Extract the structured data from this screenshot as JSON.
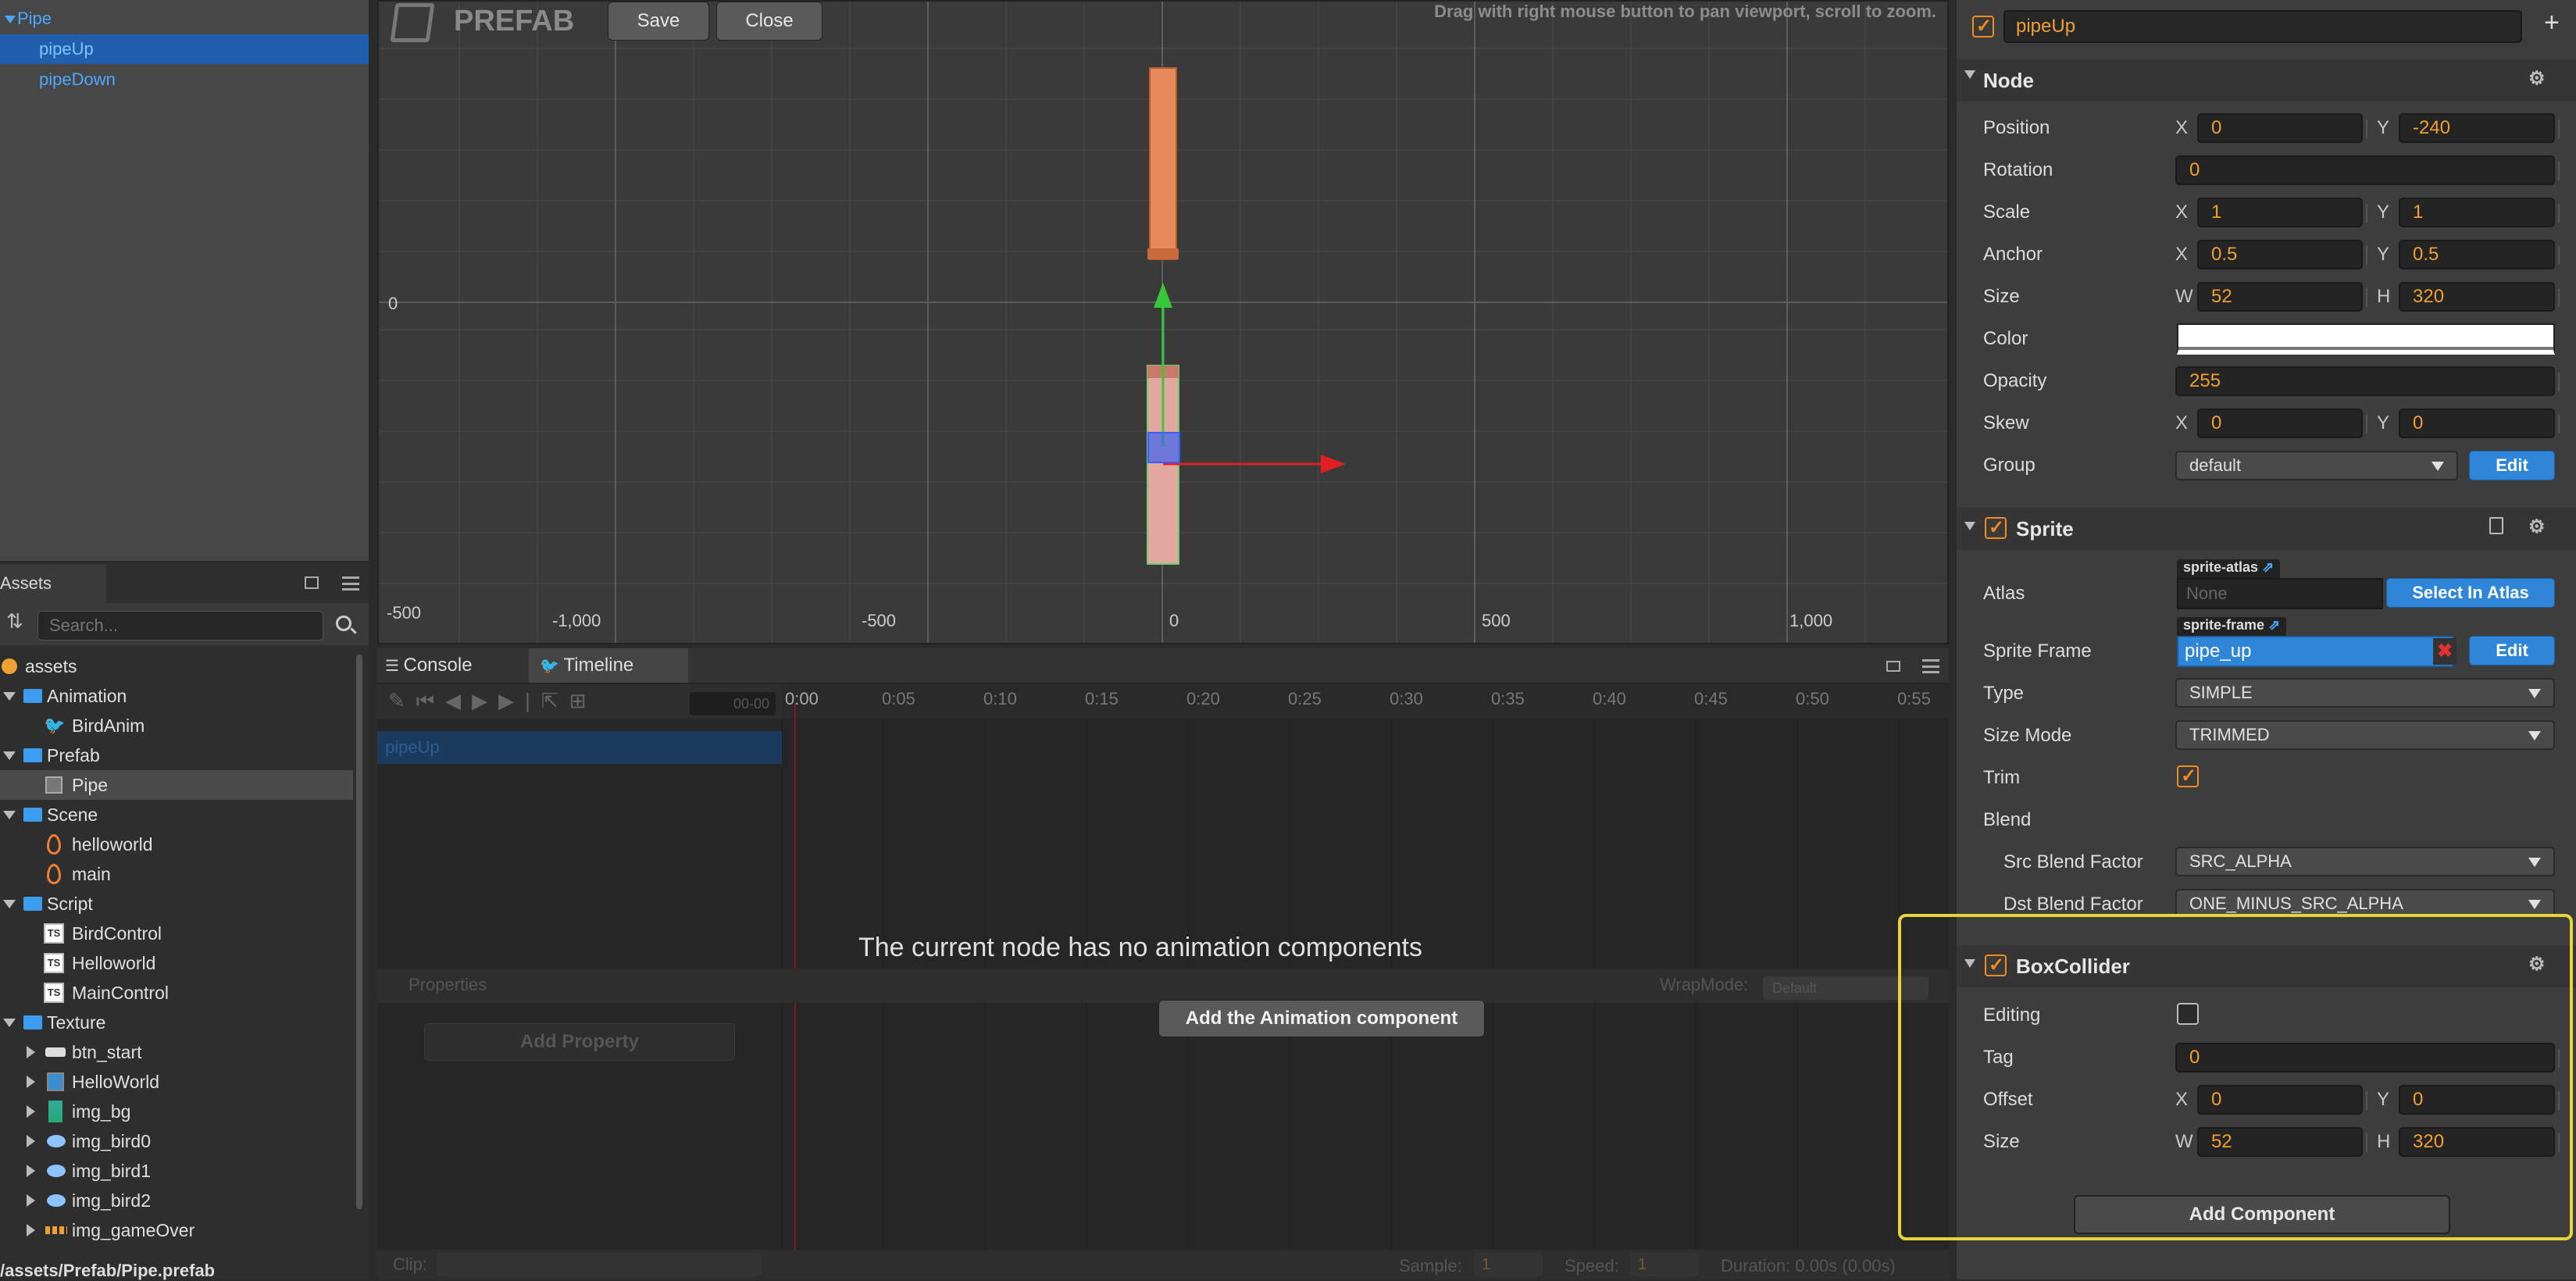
{
  "hierarchy": {
    "root": "Pipe",
    "children": [
      "pipeUp",
      "pipeDown"
    ]
  },
  "assets_panel": {
    "tab": "Assets",
    "search_placeholder": "Search...",
    "tree": [
      {
        "label": "assets",
        "kind": "root"
      },
      {
        "label": "Animation",
        "kind": "folder"
      },
      {
        "label": "BirdAnim",
        "kind": "anim"
      },
      {
        "label": "Prefab",
        "kind": "folder"
      },
      {
        "label": "Pipe",
        "kind": "prefab"
      },
      {
        "label": "Scene",
        "kind": "folder"
      },
      {
        "label": "helloworld",
        "kind": "scene"
      },
      {
        "label": "main",
        "kind": "scene"
      },
      {
        "label": "Script",
        "kind": "folder"
      },
      {
        "label": "BirdControl",
        "kind": "ts"
      },
      {
        "label": "Helloworld",
        "kind": "ts"
      },
      {
        "label": "MainControl",
        "kind": "ts"
      },
      {
        "label": "Texture",
        "kind": "folder"
      },
      {
        "label": "btn_start",
        "kind": "tex"
      },
      {
        "label": "HelloWorld",
        "kind": "tex"
      },
      {
        "label": "img_bg",
        "kind": "tex"
      },
      {
        "label": "img_bird0",
        "kind": "tex"
      },
      {
        "label": "img_bird1",
        "kind": "tex"
      },
      {
        "label": "img_bird2",
        "kind": "tex"
      },
      {
        "label": "img_gameOver",
        "kind": "tex"
      }
    ],
    "path": "/assets/Prefab/Pipe.prefab"
  },
  "scene": {
    "mode_label": "PREFAB",
    "save": "Save",
    "close": "Close",
    "hint": "Drag with right mouse button to pan viewport, scroll to zoom.",
    "y_labels": [
      "0",
      "-500"
    ],
    "x_labels": [
      "-1,000",
      "-500",
      "0",
      "500",
      "1,000"
    ]
  },
  "timeline": {
    "tab_console": "Console",
    "tab_timeline": "Timeline",
    "time_display": "00-00",
    "ticks": [
      "0:00",
      "0:05",
      "0:10",
      "0:15",
      "0:20",
      "0:25",
      "0:30",
      "0:35",
      "0:40",
      "0:45",
      "0:50",
      "0:55"
    ],
    "node_name": "pipeUp",
    "no_anim_msg": "The current node has no animation components",
    "add_anim_btn": "Add the Animation component",
    "properties": "Properties",
    "wrapmode_label": "WrapMode:",
    "wrapmode_value": "Default",
    "add_property": "Add Property",
    "clip_label": "Clip:",
    "sample_label": "Sample:",
    "sample_value": "1",
    "speed_label": "Speed:",
    "speed_value": "1",
    "duration": "Duration: 0.00s (0.00s)"
  },
  "inspector": {
    "node_name": "pipeUp",
    "node_section": "Node",
    "position": {
      "label": "Position",
      "x": "0",
      "y": "-240"
    },
    "rotation": {
      "label": "Rotation",
      "value": "0"
    },
    "scale": {
      "label": "Scale",
      "x": "1",
      "y": "1"
    },
    "anchor": {
      "label": "Anchor",
      "x": "0.5",
      "y": "0.5"
    },
    "size": {
      "label": "Size",
      "w": "52",
      "h": "320"
    },
    "color": {
      "label": "Color",
      "value": "#ffffff"
    },
    "opacity": {
      "label": "Opacity",
      "value": "255"
    },
    "skew": {
      "label": "Skew",
      "x": "0",
      "y": "0"
    },
    "group": {
      "label": "Group",
      "value": "default",
      "edit": "Edit"
    },
    "sprite": {
      "title": "Sprite",
      "atlas_label": "Atlas",
      "atlas_tag": "sprite-atlas",
      "atlas_value": "None",
      "select_in_atlas": "Select In Atlas",
      "frame_label": "Sprite Frame",
      "frame_tag": "sprite-frame",
      "frame_value": "pipe_up",
      "frame_edit": "Edit",
      "type_label": "Type",
      "type_value": "SIMPLE",
      "sizemode_label": "Size Mode",
      "sizemode_value": "TRIMMED",
      "trim_label": "Trim",
      "blend_label": "Blend",
      "src_label": "Src Blend Factor",
      "src_value": "SRC_ALPHA",
      "dst_label": "Dst Blend Factor",
      "dst_value": "ONE_MINUS_SRC_ALPHA"
    },
    "box_collider": {
      "title": "BoxCollider",
      "editing_label": "Editing",
      "tag_label": "Tag",
      "tag_value": "0",
      "offset_label": "Offset",
      "offset_x": "0",
      "offset_y": "0",
      "size_label": "Size",
      "size_w": "52",
      "size_h": "320"
    },
    "add_component": "Add Component",
    "axis": {
      "x": "X",
      "y": "Y",
      "w": "W",
      "h": "H"
    },
    "plus": "+"
  },
  "colors": {
    "accent": "#2f86d8",
    "highlight": "#e6d43a",
    "number": "#f0a030"
  }
}
